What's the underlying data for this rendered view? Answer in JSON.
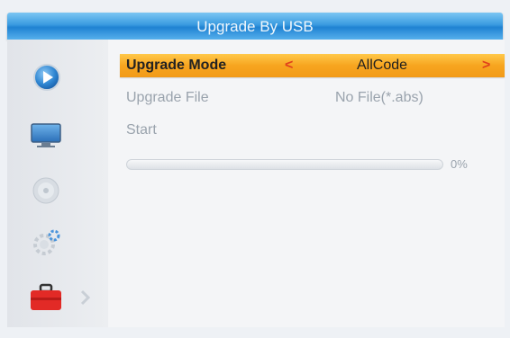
{
  "title": "Upgrade By USB",
  "rows": [
    {
      "label": "Upgrade Mode",
      "value": "AllCode",
      "selected": true
    },
    {
      "label": "Upgrade File",
      "value": "No File(*.abs)"
    },
    {
      "label": "Start"
    }
  ],
  "progress": {
    "percent": 0,
    "text": "0%"
  },
  "icons": {
    "play": "play-icon",
    "tv": "tv-icon",
    "disc": "disc-icon",
    "settings": "settings-gear-icon",
    "toolbox": "toolbox-icon",
    "chevron": "chevron-right-icon"
  },
  "colors": {
    "title_bar": "#3a9be0",
    "highlight": "#f7a51f",
    "highlight_arrow": "#e0401c",
    "text_dim": "#9aa3ad",
    "background": "#f4f5f7"
  }
}
